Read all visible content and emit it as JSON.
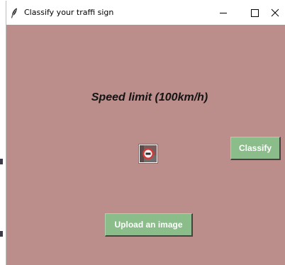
{
  "window": {
    "title": "Classify your traffi sign",
    "app_icon": "feather-icon",
    "controls": {
      "minimize_icon": "minimize-icon",
      "maximize_icon": "maximize-icon",
      "close_icon": "close-icon"
    }
  },
  "main": {
    "background_color": "#bb8d8b",
    "result_label": "Speed limit (100km/h)",
    "thumbnail_icon": "speed-limit-sign-icon",
    "classify_button": "Classify",
    "upload_button": "Upload an image",
    "button_color": "#8bbd8b"
  }
}
